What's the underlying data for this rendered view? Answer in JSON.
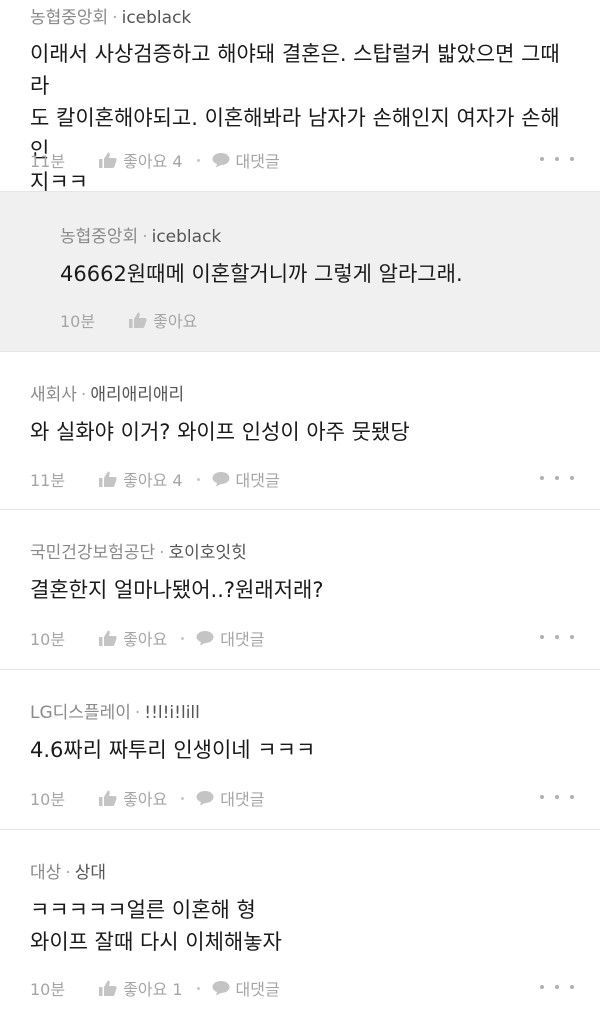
{
  "comments": [
    {
      "company": "농협중앙회",
      "nickname": "iceblack",
      "lines": [
        "이래서 사상검증하고 해야돼 결혼은. 스탑럴커 밟았으면 그때라",
        "도 칼이혼해야되고. 이혼해봐라 남자가 손해인지 여자가 손해인",
        "지ㅋㅋ"
      ],
      "time": "11분",
      "like_label": "좋아요 4",
      "reply_label": "대댓글"
    },
    {
      "company": "농협중앙회",
      "nickname": "iceblack",
      "lines": [
        "46662원때메 이혼할거니까 그렇게 알라그래."
      ],
      "time": "10분",
      "like_label": "좋아요"
    },
    {
      "company": "새회사",
      "nickname": "애리애리애리",
      "lines": [
        "와 실화야 이거? 와이프 인성이 아주 뭇됐당"
      ],
      "time": "11분",
      "like_label": "좋아요 4",
      "reply_label": "대댓글"
    },
    {
      "company": "국민건강보험공단",
      "nickname": "호이호잇힛",
      "lines": [
        "결혼한지 얼마나됐어..?원래저래?"
      ],
      "time": "10분",
      "like_label": "좋아요",
      "reply_label": "대댓글"
    },
    {
      "company": "LG디스플레이",
      "nickname": "!!l!i!lill",
      "lines": [
        "4.6짜리 짜투리 인생이네 ㅋㅋㅋ"
      ],
      "time": "10분",
      "like_label": "좋아요",
      "reply_label": "대댓글"
    },
    {
      "company": "대상",
      "nickname": "상대",
      "lines": [
        "ㅋㅋㅋㅋㅋ얼른 이혼해 형",
        "와이프 잘때 다시 이체해놓자"
      ],
      "time": "10분",
      "like_label": "좋아요 1",
      "reply_label": "대댓글"
    }
  ],
  "icons": {
    "like": "thumbs-up-icon",
    "reply": "speech-bubble-icon",
    "more": "more-dots-icon"
  },
  "colors": {
    "reply_background": "#f0f0f0",
    "meta_text": "#8a8a8a",
    "action_text": "#a5a5a5"
  }
}
